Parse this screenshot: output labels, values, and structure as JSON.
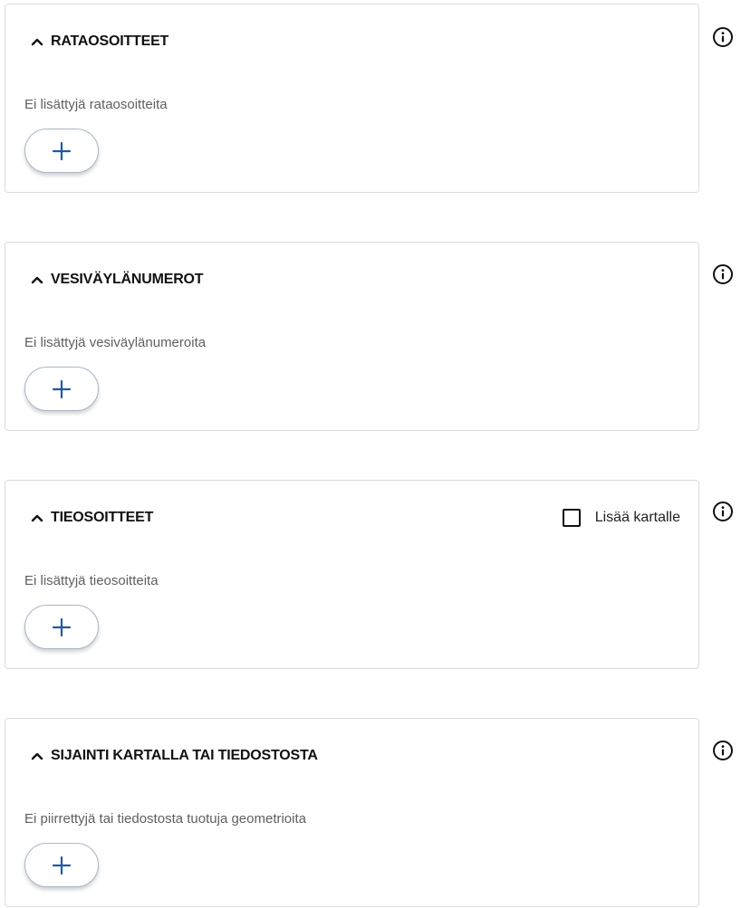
{
  "sections": [
    {
      "title": "RATAOSOITTEET",
      "empty_text": "Ei lisättyjä rataosoitteita",
      "add_symbol": "+"
    },
    {
      "title": "VESIVÄYLÄNUMEROT",
      "empty_text": "Ei lisättyjä vesiväylänumeroita",
      "add_symbol": "+"
    },
    {
      "title": "TIEOSOITTEET",
      "empty_text": "Ei lisättyjä tieosoitteita",
      "add_symbol": "+",
      "checkbox_label": "Lisää kartalle",
      "checkbox_checked": false
    },
    {
      "title": "SIJAINTI KARTALLA TAI TIEDOSTOSTA",
      "empty_text": "Ei piirrettyjä tai tiedostosta tuotuja geometrioita",
      "add_symbol": "+"
    }
  ],
  "colors": {
    "plus_icon": "#1f5aa8",
    "border": "#dcdcdc",
    "muted_text": "#5f5f5f"
  }
}
